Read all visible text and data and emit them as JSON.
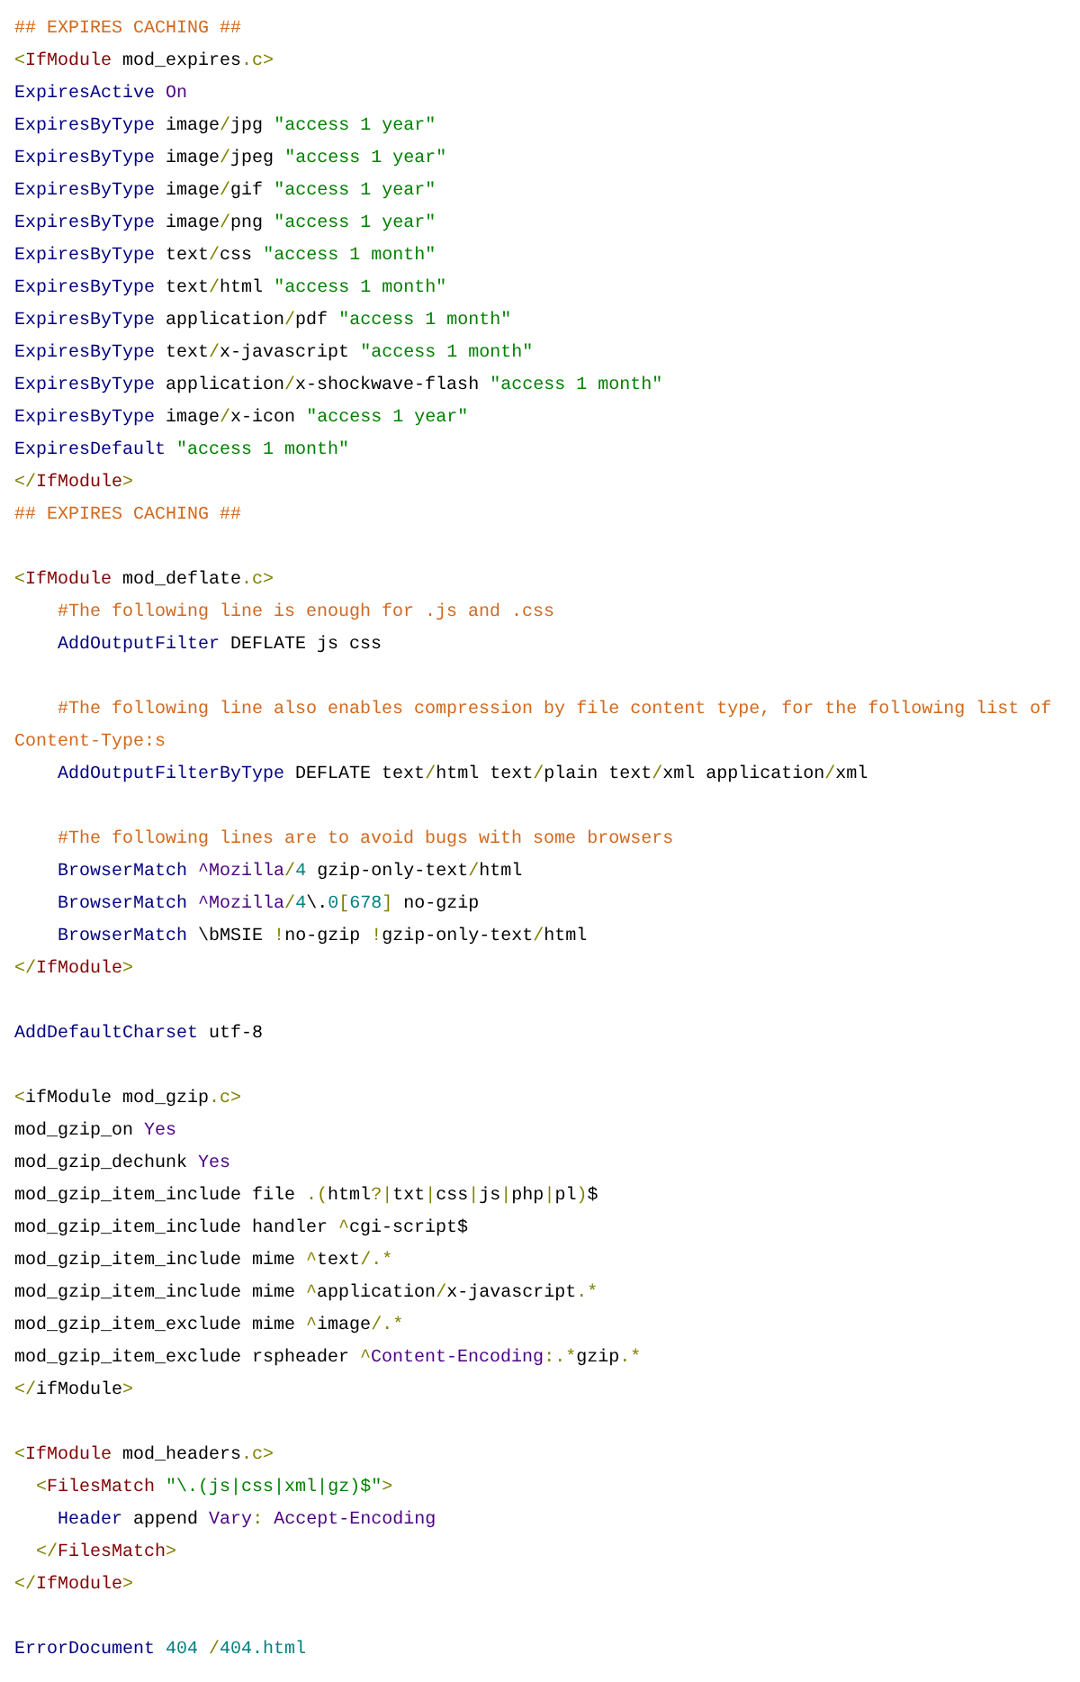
{
  "code_blocks": [
    {
      "lines": [
        {
          "tokens": [
            {
              "text": "## EXPIRES CACHING ##",
              "kind": "comment"
            }
          ]
        },
        {
          "tokens": [
            {
              "text": "<",
              "kind": "punct"
            },
            {
              "text": "IfModule",
              "kind": "tag"
            },
            {
              "text": " mod_expires",
              "kind": "plain"
            },
            {
              "text": ".c>",
              "kind": "punct"
            }
          ]
        },
        {
          "tokens": [
            {
              "text": "ExpiresActive",
              "kind": "keyword"
            },
            {
              "text": " On",
              "kind": "value"
            }
          ]
        },
        {
          "tokens": [
            {
              "text": "ExpiresByType",
              "kind": "keyword"
            },
            {
              "text": " image",
              "kind": "plain"
            },
            {
              "text": "/",
              "kind": "punct"
            },
            {
              "text": "jpg ",
              "kind": "plain"
            },
            {
              "text": "\"access 1 year\"",
              "kind": "string"
            }
          ]
        },
        {
          "tokens": [
            {
              "text": "ExpiresByType",
              "kind": "keyword"
            },
            {
              "text": " image",
              "kind": "plain"
            },
            {
              "text": "/",
              "kind": "punct"
            },
            {
              "text": "jpeg ",
              "kind": "plain"
            },
            {
              "text": "\"access 1 year\"",
              "kind": "string"
            }
          ]
        },
        {
          "tokens": [
            {
              "text": "ExpiresByType",
              "kind": "keyword"
            },
            {
              "text": " image",
              "kind": "plain"
            },
            {
              "text": "/",
              "kind": "punct"
            },
            {
              "text": "gif ",
              "kind": "plain"
            },
            {
              "text": "\"access 1 year\"",
              "kind": "string"
            }
          ]
        },
        {
          "tokens": [
            {
              "text": "ExpiresByType",
              "kind": "keyword"
            },
            {
              "text": " image",
              "kind": "plain"
            },
            {
              "text": "/",
              "kind": "punct"
            },
            {
              "text": "png ",
              "kind": "plain"
            },
            {
              "text": "\"access 1 year\"",
              "kind": "string"
            }
          ]
        },
        {
          "tokens": [
            {
              "text": "ExpiresByType",
              "kind": "keyword"
            },
            {
              "text": " text",
              "kind": "plain"
            },
            {
              "text": "/",
              "kind": "punct"
            },
            {
              "text": "css ",
              "kind": "plain"
            },
            {
              "text": "\"access 1 month\"",
              "kind": "string"
            }
          ]
        },
        {
          "tokens": [
            {
              "text": "ExpiresByType",
              "kind": "keyword"
            },
            {
              "text": " text",
              "kind": "plain"
            },
            {
              "text": "/",
              "kind": "punct"
            },
            {
              "text": "html ",
              "kind": "plain"
            },
            {
              "text": "\"access 1 month\"",
              "kind": "string"
            }
          ]
        },
        {
          "tokens": [
            {
              "text": "ExpiresByType",
              "kind": "keyword"
            },
            {
              "text": " application",
              "kind": "plain"
            },
            {
              "text": "/",
              "kind": "punct"
            },
            {
              "text": "pdf ",
              "kind": "plain"
            },
            {
              "text": "\"access 1 month\"",
              "kind": "string"
            }
          ]
        },
        {
          "tokens": [
            {
              "text": "ExpiresByType",
              "kind": "keyword"
            },
            {
              "text": " text",
              "kind": "plain"
            },
            {
              "text": "/",
              "kind": "punct"
            },
            {
              "text": "x-javascript ",
              "kind": "plain"
            },
            {
              "text": "\"access 1 month\"",
              "kind": "string"
            }
          ]
        },
        {
          "tokens": [
            {
              "text": "ExpiresByType",
              "kind": "keyword"
            },
            {
              "text": " application",
              "kind": "plain"
            },
            {
              "text": "/",
              "kind": "punct"
            },
            {
              "text": "x-shockwave-flash ",
              "kind": "plain"
            },
            {
              "text": "\"access 1 month\"",
              "kind": "string"
            }
          ]
        },
        {
          "tokens": [
            {
              "text": "ExpiresByType",
              "kind": "keyword"
            },
            {
              "text": " image",
              "kind": "plain"
            },
            {
              "text": "/",
              "kind": "punct"
            },
            {
              "text": "x-icon ",
              "kind": "plain"
            },
            {
              "text": "\"access 1 year\"",
              "kind": "string"
            }
          ]
        },
        {
          "tokens": [
            {
              "text": "ExpiresDefault",
              "kind": "keyword"
            },
            {
              "text": " \"access 1 month\"",
              "kind": "string"
            }
          ]
        },
        {
          "tokens": [
            {
              "text": "</",
              "kind": "punct"
            },
            {
              "text": "IfModule",
              "kind": "tag"
            },
            {
              "text": ">",
              "kind": "punct"
            }
          ]
        },
        {
          "tokens": [
            {
              "text": "## EXPIRES CACHING ##",
              "kind": "comment"
            }
          ]
        }
      ]
    },
    {
      "lines": [
        {
          "tokens": [
            {
              "text": "<",
              "kind": "punct"
            },
            {
              "text": "IfModule",
              "kind": "tag"
            },
            {
              "text": " mod_deflate",
              "kind": "plain"
            },
            {
              "text": ".c>",
              "kind": "punct"
            }
          ]
        },
        {
          "tokens": [
            {
              "text": "    #The following line is enough for .js and .css",
              "kind": "comment"
            }
          ]
        },
        {
          "tokens": [
            {
              "text": "    AddOutputFilter",
              "kind": "keyword"
            },
            {
              "text": " DEFLATE js css",
              "kind": "plain"
            }
          ]
        }
      ]
    },
    {
      "lines": [
        {
          "tokens": [
            {
              "text": "    #The following line also enables compression by file content type, for the following list of Content-Type:s",
              "kind": "comment"
            }
          ]
        },
        {
          "tokens": [
            {
              "text": "    AddOutputFilterByType",
              "kind": "keyword"
            },
            {
              "text": " DEFLATE text",
              "kind": "plain"
            },
            {
              "text": "/",
              "kind": "punct"
            },
            {
              "text": "html text",
              "kind": "plain"
            },
            {
              "text": "/",
              "kind": "punct"
            },
            {
              "text": "plain text",
              "kind": "plain"
            },
            {
              "text": "/",
              "kind": "punct"
            },
            {
              "text": "xml application",
              "kind": "plain"
            },
            {
              "text": "/",
              "kind": "punct"
            },
            {
              "text": "xml",
              "kind": "plain"
            }
          ]
        }
      ]
    },
    {
      "lines": [
        {
          "tokens": [
            {
              "text": "    #The following lines are to avoid bugs with some browsers",
              "kind": "comment"
            }
          ]
        },
        {
          "tokens": [
            {
              "text": "    BrowserMatch",
              "kind": "keyword"
            },
            {
              "text": " ^Mozilla",
              "kind": "value"
            },
            {
              "text": "/",
              "kind": "punct"
            },
            {
              "text": "4",
              "kind": "number"
            },
            {
              "text": " gzip-only-text",
              "kind": "plain"
            },
            {
              "text": "/",
              "kind": "punct"
            },
            {
              "text": "html",
              "kind": "plain"
            }
          ]
        },
        {
          "tokens": [
            {
              "text": "    BrowserMatch",
              "kind": "keyword"
            },
            {
              "text": " ^Mozilla",
              "kind": "value"
            },
            {
              "text": "/",
              "kind": "punct"
            },
            {
              "text": "4",
              "kind": "number"
            },
            {
              "text": "\\.",
              "kind": "plain"
            },
            {
              "text": "0",
              "kind": "number"
            },
            {
              "text": "[",
              "kind": "punct"
            },
            {
              "text": "678",
              "kind": "number"
            },
            {
              "text": "]",
              "kind": "punct"
            },
            {
              "text": " no-gzip",
              "kind": "plain"
            }
          ]
        },
        {
          "tokens": [
            {
              "text": "    BrowserMatch",
              "kind": "keyword"
            },
            {
              "text": " \\bMSIE ",
              "kind": "plain"
            },
            {
              "text": "!",
              "kind": "punct"
            },
            {
              "text": "no-gzip ",
              "kind": "plain"
            },
            {
              "text": "!",
              "kind": "punct"
            },
            {
              "text": "gzip-only-text",
              "kind": "plain"
            },
            {
              "text": "/",
              "kind": "punct"
            },
            {
              "text": "html",
              "kind": "plain"
            }
          ]
        },
        {
          "tokens": [
            {
              "text": "</",
              "kind": "punct"
            },
            {
              "text": "IfModule",
              "kind": "tag"
            },
            {
              "text": ">",
              "kind": "punct"
            }
          ]
        }
      ]
    },
    {
      "lines": [
        {
          "tokens": [
            {
              "text": "AddDefaultCharset",
              "kind": "keyword"
            },
            {
              "text": " utf-8",
              "kind": "plain"
            }
          ]
        }
      ]
    },
    {
      "lines": [
        {
          "tokens": [
            {
              "text": "<",
              "kind": "punct"
            },
            {
              "text": "ifModule mod_gzip",
              "kind": "plain"
            },
            {
              "text": ".c>",
              "kind": "punct"
            }
          ]
        },
        {
          "tokens": [
            {
              "text": "mod_gzip_on ",
              "kind": "plain"
            },
            {
              "text": "Yes",
              "kind": "value"
            }
          ]
        },
        {
          "tokens": [
            {
              "text": "mod_gzip_dechunk ",
              "kind": "plain"
            },
            {
              "text": "Yes",
              "kind": "value"
            }
          ]
        },
        {
          "tokens": [
            {
              "text": "mod_gzip_item_include file ",
              "kind": "plain"
            },
            {
              "text": ".(",
              "kind": "punct"
            },
            {
              "text": "html",
              "kind": "plain"
            },
            {
              "text": "?|",
              "kind": "punct"
            },
            {
              "text": "txt",
              "kind": "plain"
            },
            {
              "text": "|",
              "kind": "punct"
            },
            {
              "text": "css",
              "kind": "plain"
            },
            {
              "text": "|",
              "kind": "punct"
            },
            {
              "text": "js",
              "kind": "plain"
            },
            {
              "text": "|",
              "kind": "punct"
            },
            {
              "text": "php",
              "kind": "plain"
            },
            {
              "text": "|",
              "kind": "punct"
            },
            {
              "text": "pl",
              "kind": "plain"
            },
            {
              "text": ")",
              "kind": "punct"
            },
            {
              "text": "$",
              "kind": "plain"
            }
          ]
        },
        {
          "tokens": [
            {
              "text": "mod_gzip_item_include handler ",
              "kind": "plain"
            },
            {
              "text": "^",
              "kind": "punct"
            },
            {
              "text": "cgi-script$",
              "kind": "plain"
            }
          ]
        },
        {
          "tokens": [
            {
              "text": "mod_gzip_item_include mime ",
              "kind": "plain"
            },
            {
              "text": "^",
              "kind": "punct"
            },
            {
              "text": "text",
              "kind": "plain"
            },
            {
              "text": "/.*",
              "kind": "punct"
            }
          ]
        },
        {
          "tokens": [
            {
              "text": "mod_gzip_item_include mime ",
              "kind": "plain"
            },
            {
              "text": "^",
              "kind": "punct"
            },
            {
              "text": "application",
              "kind": "plain"
            },
            {
              "text": "/",
              "kind": "punct"
            },
            {
              "text": "x-javascript",
              "kind": "plain"
            },
            {
              "text": ".*",
              "kind": "punct"
            }
          ]
        },
        {
          "tokens": [
            {
              "text": "mod_gzip_item_exclude mime ",
              "kind": "plain"
            },
            {
              "text": "^",
              "kind": "punct"
            },
            {
              "text": "image",
              "kind": "plain"
            },
            {
              "text": "/.*",
              "kind": "punct"
            }
          ]
        },
        {
          "tokens": [
            {
              "text": "mod_gzip_item_exclude rspheader ",
              "kind": "plain"
            },
            {
              "text": "^",
              "kind": "punct"
            },
            {
              "text": "Content-Encoding",
              "kind": "value"
            },
            {
              "text": ":.*",
              "kind": "punct"
            },
            {
              "text": "gzip",
              "kind": "plain"
            },
            {
              "text": ".*",
              "kind": "punct"
            }
          ]
        },
        {
          "tokens": [
            {
              "text": "</",
              "kind": "punct"
            },
            {
              "text": "ifModule",
              "kind": "plain"
            },
            {
              "text": ">",
              "kind": "punct"
            }
          ]
        }
      ]
    },
    {
      "lines": [
        {
          "tokens": [
            {
              "text": "<",
              "kind": "punct"
            },
            {
              "text": "IfModule",
              "kind": "tag"
            },
            {
              "text": " mod_headers",
              "kind": "plain"
            },
            {
              "text": ".c>",
              "kind": "punct"
            }
          ]
        },
        {
          "tokens": [
            {
              "text": "  <",
              "kind": "punct"
            },
            {
              "text": "FilesMatch",
              "kind": "tag"
            },
            {
              "text": " \"\\.(js|css|xml|gz)$\"",
              "kind": "string"
            },
            {
              "text": ">",
              "kind": "punct"
            }
          ]
        },
        {
          "tokens": [
            {
              "text": "    Header",
              "kind": "keyword"
            },
            {
              "text": " append ",
              "kind": "plain"
            },
            {
              "text": "Vary",
              "kind": "value"
            },
            {
              "text": ":",
              "kind": "punct"
            },
            {
              "text": " Accept-Encoding",
              "kind": "value"
            }
          ]
        },
        {
          "tokens": [
            {
              "text": "  </",
              "kind": "punct"
            },
            {
              "text": "FilesMatch",
              "kind": "tag"
            },
            {
              "text": ">",
              "kind": "punct"
            }
          ]
        },
        {
          "tokens": [
            {
              "text": "</",
              "kind": "punct"
            },
            {
              "text": "IfModule",
              "kind": "tag"
            },
            {
              "text": ">",
              "kind": "punct"
            }
          ]
        }
      ]
    },
    {
      "lines": [
        {
          "tokens": [
            {
              "text": "ErrorDocument",
              "kind": "keyword"
            },
            {
              "text": " 404",
              "kind": "number"
            },
            {
              "text": " /",
              "kind": "punct"
            },
            {
              "text": "404.html",
              "kind": "number"
            }
          ]
        }
      ]
    }
  ]
}
